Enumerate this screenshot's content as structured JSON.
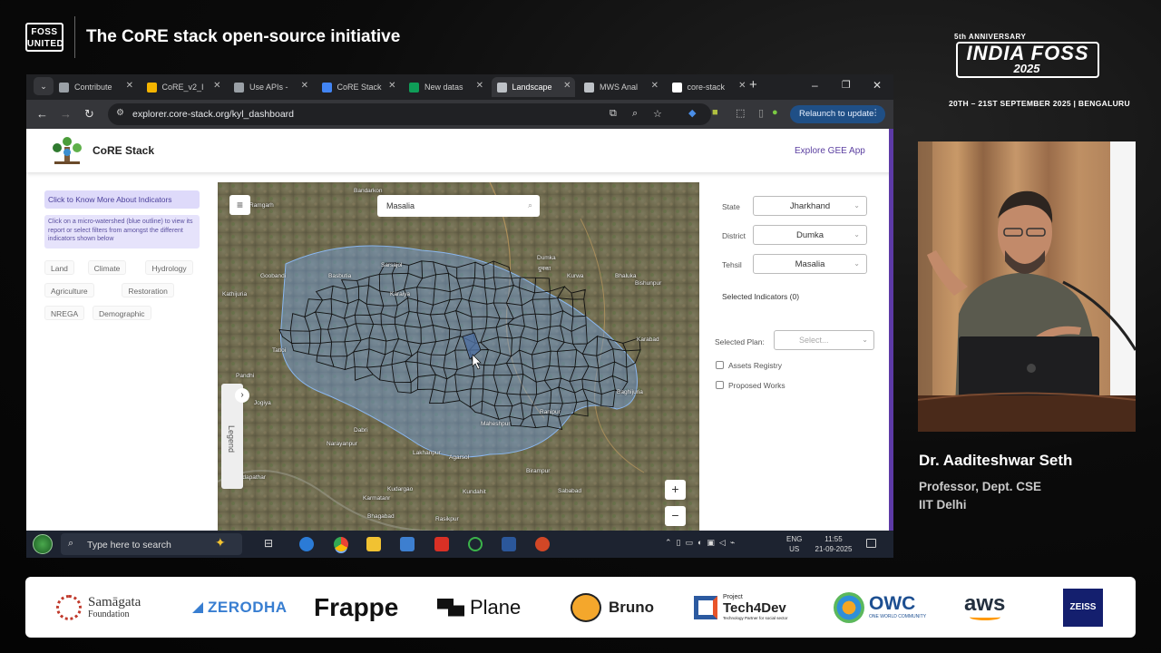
{
  "header": {
    "org_logo_line1": "FOSS",
    "org_logo_line2": "UNITED",
    "talk_title": "The CoRE stack open-source initiative",
    "event_anniversary": "5th ANNIVERSARY",
    "event_name": "INDIA FOSS",
    "event_year": "2025",
    "event_dates": "20TH – 21ST SEPTEMBER 2025  |  BENGALURU"
  },
  "browser": {
    "tabs": [
      {
        "title": "Contribute",
        "icon": "wordpress-icon",
        "color": "#9aa0a6"
      },
      {
        "title": "CoRE_v2_I",
        "icon": "google-drive-icon",
        "color": "#f4b400"
      },
      {
        "title": "Use APIs -",
        "icon": "wordpress-icon",
        "color": "#9aa0a6"
      },
      {
        "title": "CoRE Stack",
        "icon": "docs-icon",
        "color": "#4285f4"
      },
      {
        "title": "New datas",
        "icon": "sheets-icon",
        "color": "#0f9d58"
      },
      {
        "title": "Landscape",
        "icon": "image-icon",
        "color": "#bdc1c6"
      },
      {
        "title": "MWS Anal",
        "icon": "globe-icon",
        "color": "#bdc1c6"
      },
      {
        "title": "core-stack",
        "icon": "github-icon",
        "color": "#ffffff"
      }
    ],
    "active_tab": 5,
    "url": "explorer.core-stack.org/kyl_dashboard",
    "relaunch_label": "Relaunch to update"
  },
  "site": {
    "brand": "CoRE Stack",
    "explore_link": "Explore GEE App",
    "indicators_button": "Click to Know More About Indicators",
    "info_text": "Click on a micro-watershed (blue outline) to view its report or select filters from amongst the different indicators shown below",
    "chips": [
      "Land",
      "Climate",
      "Hydrology",
      "Agriculture",
      "Restoration",
      "NREGA",
      "Demographic"
    ],
    "map": {
      "search_value": "Masalia",
      "legend_label": "Legend",
      "labels": [
        "Bandarkon",
        "Ramgarh",
        "Dumka",
        "दुमका",
        "Kurwa",
        "Basbutia",
        "Sarsajol",
        "Bhaluka",
        "Karabad",
        "Goobandi",
        "Bishunpur",
        "Tatloi",
        "Karaiya",
        "Pandhi",
        "Jogiya",
        "Dabri",
        "Kathijuria",
        "Lakhanpur",
        "Agarsol",
        "Narayanpur",
        "Maheshpur",
        "Bindapathar",
        "Karmatanr",
        "Kudargao",
        "Kundahit",
        "Sababad",
        "Rasikpur",
        "Bhagabad",
        "Baghijuria",
        "Ranipur",
        "Birampur"
      ]
    },
    "filters": {
      "state_label": "State",
      "state_value": "Jharkhand",
      "district_label": "District",
      "district_value": "Dumka",
      "tehsil_label": "Tehsil",
      "tehsil_value": "Masalia"
    },
    "selected_indicators": "Selected Indicators (0)",
    "selected_plan_label": "Selected Plan:",
    "selected_plan_placeholder": "Select...",
    "checkboxes": [
      "Assets Registry",
      "Proposed Works"
    ]
  },
  "taskbar": {
    "search_placeholder": "Type here to search",
    "lang_top": "ENG",
    "lang_bottom": "US",
    "time": "11:55",
    "date": "21-09-2025"
  },
  "speaker": {
    "name": "Dr. Aaditeshwar Seth",
    "role_line1": "Professor, Dept. CSE",
    "role_line2": "IIT Delhi"
  },
  "sponsors": {
    "samagata_line1": "Samāgata",
    "samagata_line2": "Foundation",
    "zerodha": "ZERODHA",
    "frappe": "Frappe",
    "plane": "Plane",
    "bruno": "Bruno",
    "tech4dev_small": "Project",
    "tech4dev": "Tech4Dev",
    "tech4dev_tag": "Technology Partner for social sector",
    "owc": "OWC",
    "owc_tag": "ONE WORLD COMMUNITY",
    "aws": "aws",
    "zeiss": "ZEISS"
  },
  "colors": {
    "accent_purple": "#5d3aa6",
    "watershed_blue": "#6fa3e6",
    "chrome_dark": "#202124"
  }
}
